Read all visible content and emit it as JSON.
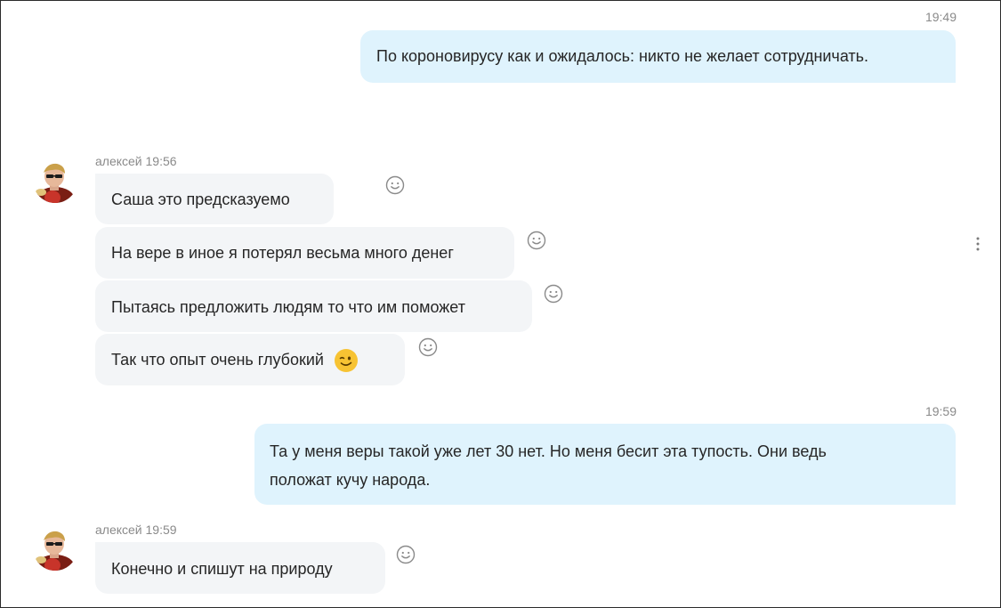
{
  "messages": [
    {
      "id": "m1",
      "dir": "out",
      "time": "19:49",
      "text": "По короновирусу как и ожидалось: никто не желает сотрудничать."
    },
    {
      "id": "g1",
      "sender": "алексей",
      "time": "19:56"
    },
    {
      "id": "m2",
      "dir": "in",
      "text": "Саша это предсказуемо"
    },
    {
      "id": "m3",
      "dir": "in",
      "text": "На вере в иное я потерял весьма много денег"
    },
    {
      "id": "m4",
      "dir": "in",
      "text": "Пытаясь предложить людям то что им поможет"
    },
    {
      "id": "m5",
      "dir": "in",
      "text": "Так что опыт очень глубокий",
      "emoji": "wink-emoji"
    },
    {
      "id": "m6",
      "dir": "out",
      "time": "19:59",
      "line1": "Та у меня веры такой уже лет 30 нет.   Но меня бесит эта тупость.  Они ведь",
      "line2": "положат кучу народа."
    },
    {
      "id": "g2",
      "sender": "алексей",
      "time": "19:59"
    },
    {
      "id": "m7",
      "dir": "in",
      "text": "Конечно и спишут на природу"
    }
  ],
  "group1_header": "алексей 19:56",
  "group2_header": "алексей 19:59",
  "icons": {
    "reaction": "smiley-reaction-icon",
    "more": "more-options-icon",
    "avatar": "contact-avatar"
  },
  "colors": {
    "outgoing_bubble": "#dff3fd",
    "incoming_bubble": "#f3f5f7",
    "meta_text": "#8a8a8a",
    "emoji": "#f7c333"
  }
}
